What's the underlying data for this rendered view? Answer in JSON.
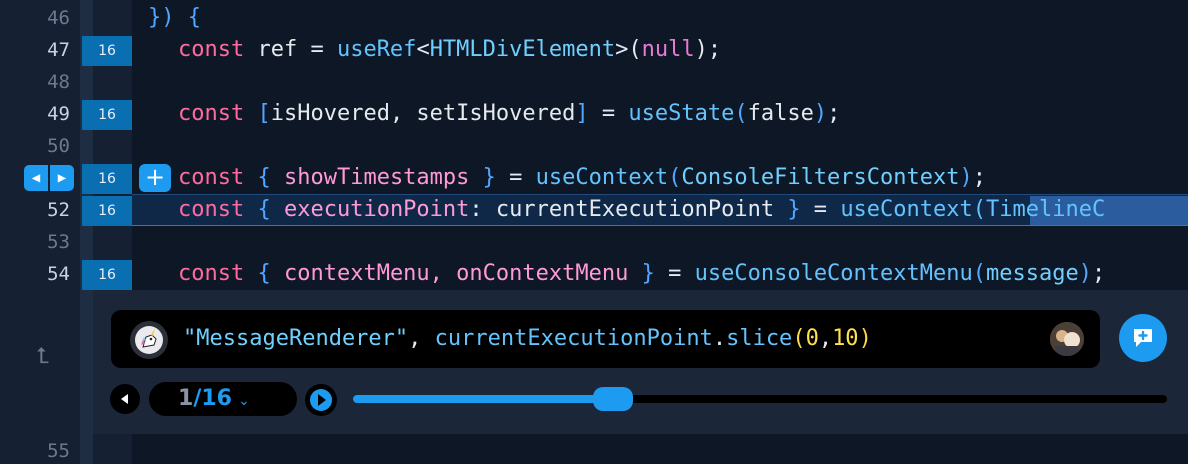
{
  "editor": {
    "lines": [
      {
        "number": "46",
        "hits": "",
        "tokens": [
          {
            "t": "}) {",
            "c": "b"
          }
        ]
      },
      {
        "number": "47",
        "hits": "16",
        "tokens": [
          {
            "t": "const",
            "c": "k"
          },
          {
            "t": " ref = ",
            "c": "w"
          },
          {
            "t": "useRef",
            "c": "fn"
          },
          {
            "t": "<",
            "c": "w"
          },
          {
            "t": "HTMLDivElement",
            "c": "ty"
          },
          {
            "t": ">(",
            "c": "w"
          },
          {
            "t": "null",
            "c": "nu"
          },
          {
            "t": ");",
            "c": "w"
          }
        ]
      },
      {
        "number": "48",
        "hits": "",
        "tokens": []
      },
      {
        "number": "49",
        "hits": "16",
        "tokens": [
          {
            "t": "const",
            "c": "k"
          },
          {
            "t": " ",
            "c": "w"
          },
          {
            "t": "[",
            "c": "b"
          },
          {
            "t": "isHovered, setIsHovered",
            "c": "w"
          },
          {
            "t": "]",
            "c": "b"
          },
          {
            "t": " = ",
            "c": "w"
          },
          {
            "t": "useState",
            "c": "fn"
          },
          {
            "t": "(",
            "c": "b"
          },
          {
            "t": "false",
            "c": "w"
          },
          {
            "t": ")",
            "c": "b"
          },
          {
            "t": ";",
            "c": "w"
          }
        ]
      },
      {
        "number": "50",
        "hits": "",
        "tokens": []
      },
      {
        "number": "",
        "hits": "16",
        "tokens": [
          {
            "t": "const",
            "c": "k"
          },
          {
            "t": " ",
            "c": "w"
          },
          {
            "t": "{",
            "c": "b"
          },
          {
            "t": " showTimestamps ",
            "c": "pr"
          },
          {
            "t": "}",
            "c": "b"
          },
          {
            "t": " = ",
            "c": "w"
          },
          {
            "t": "useContext",
            "c": "fn"
          },
          {
            "t": "(",
            "c": "b"
          },
          {
            "t": "ConsoleFiltersContext",
            "c": "ty"
          },
          {
            "t": ")",
            "c": "b"
          },
          {
            "t": ";",
            "c": "w"
          }
        ]
      },
      {
        "number": "52",
        "hits": "16",
        "tokens": [
          {
            "t": "const",
            "c": "k"
          },
          {
            "t": " ",
            "c": "w"
          },
          {
            "t": "{",
            "c": "b"
          },
          {
            "t": " executionPoint",
            "c": "pr"
          },
          {
            "t": ": currentExecutionPoint ",
            "c": "w"
          },
          {
            "t": "}",
            "c": "b"
          },
          {
            "t": " = ",
            "c": "w"
          },
          {
            "t": "useContext(TimelineC",
            "c": "fn"
          }
        ]
      },
      {
        "number": "53",
        "hits": "",
        "tokens": []
      },
      {
        "number": "54",
        "hits": "16",
        "tokens": [
          {
            "t": "const",
            "c": "k"
          },
          {
            "t": " ",
            "c": "w"
          },
          {
            "t": "{",
            "c": "b"
          },
          {
            "t": " contextMenu, onContextMenu ",
            "c": "pr"
          },
          {
            "t": "}",
            "c": "b"
          },
          {
            "t": " = ",
            "c": "w"
          },
          {
            "t": "useConsoleContextMenu",
            "c": "fn"
          },
          {
            "t": "(",
            "c": "b"
          },
          {
            "t": "message",
            "c": "ty"
          },
          {
            "t": ")",
            "c": "b"
          },
          {
            "t": ";",
            "c": "w"
          }
        ]
      }
    ],
    "bottom_line_number": "55"
  },
  "log_point": {
    "expression_tokens": [
      {
        "t": "\"MessageRenderer\"",
        "c": "str"
      },
      {
        "t": ", ",
        "c": "w"
      },
      {
        "t": "currentExecutionPoint",
        "c": "mt"
      },
      {
        "t": ".",
        "c": "w"
      },
      {
        "t": "slice",
        "c": "mt"
      },
      {
        "t": "(",
        "c": "pa"
      },
      {
        "t": "0",
        "c": "num"
      },
      {
        "t": ",",
        "c": "w"
      },
      {
        "t": "10",
        "c": "num"
      },
      {
        "t": ")",
        "c": "pa"
      }
    ]
  },
  "hit_navigator": {
    "current": "1",
    "separator": "/",
    "total": "16",
    "progress": 0.32
  },
  "colors": {
    "accent": "#1d9bf0",
    "hit_badge": "#0a6fb0",
    "keyword": "#ff6aa0",
    "function": "#62c3ff"
  }
}
